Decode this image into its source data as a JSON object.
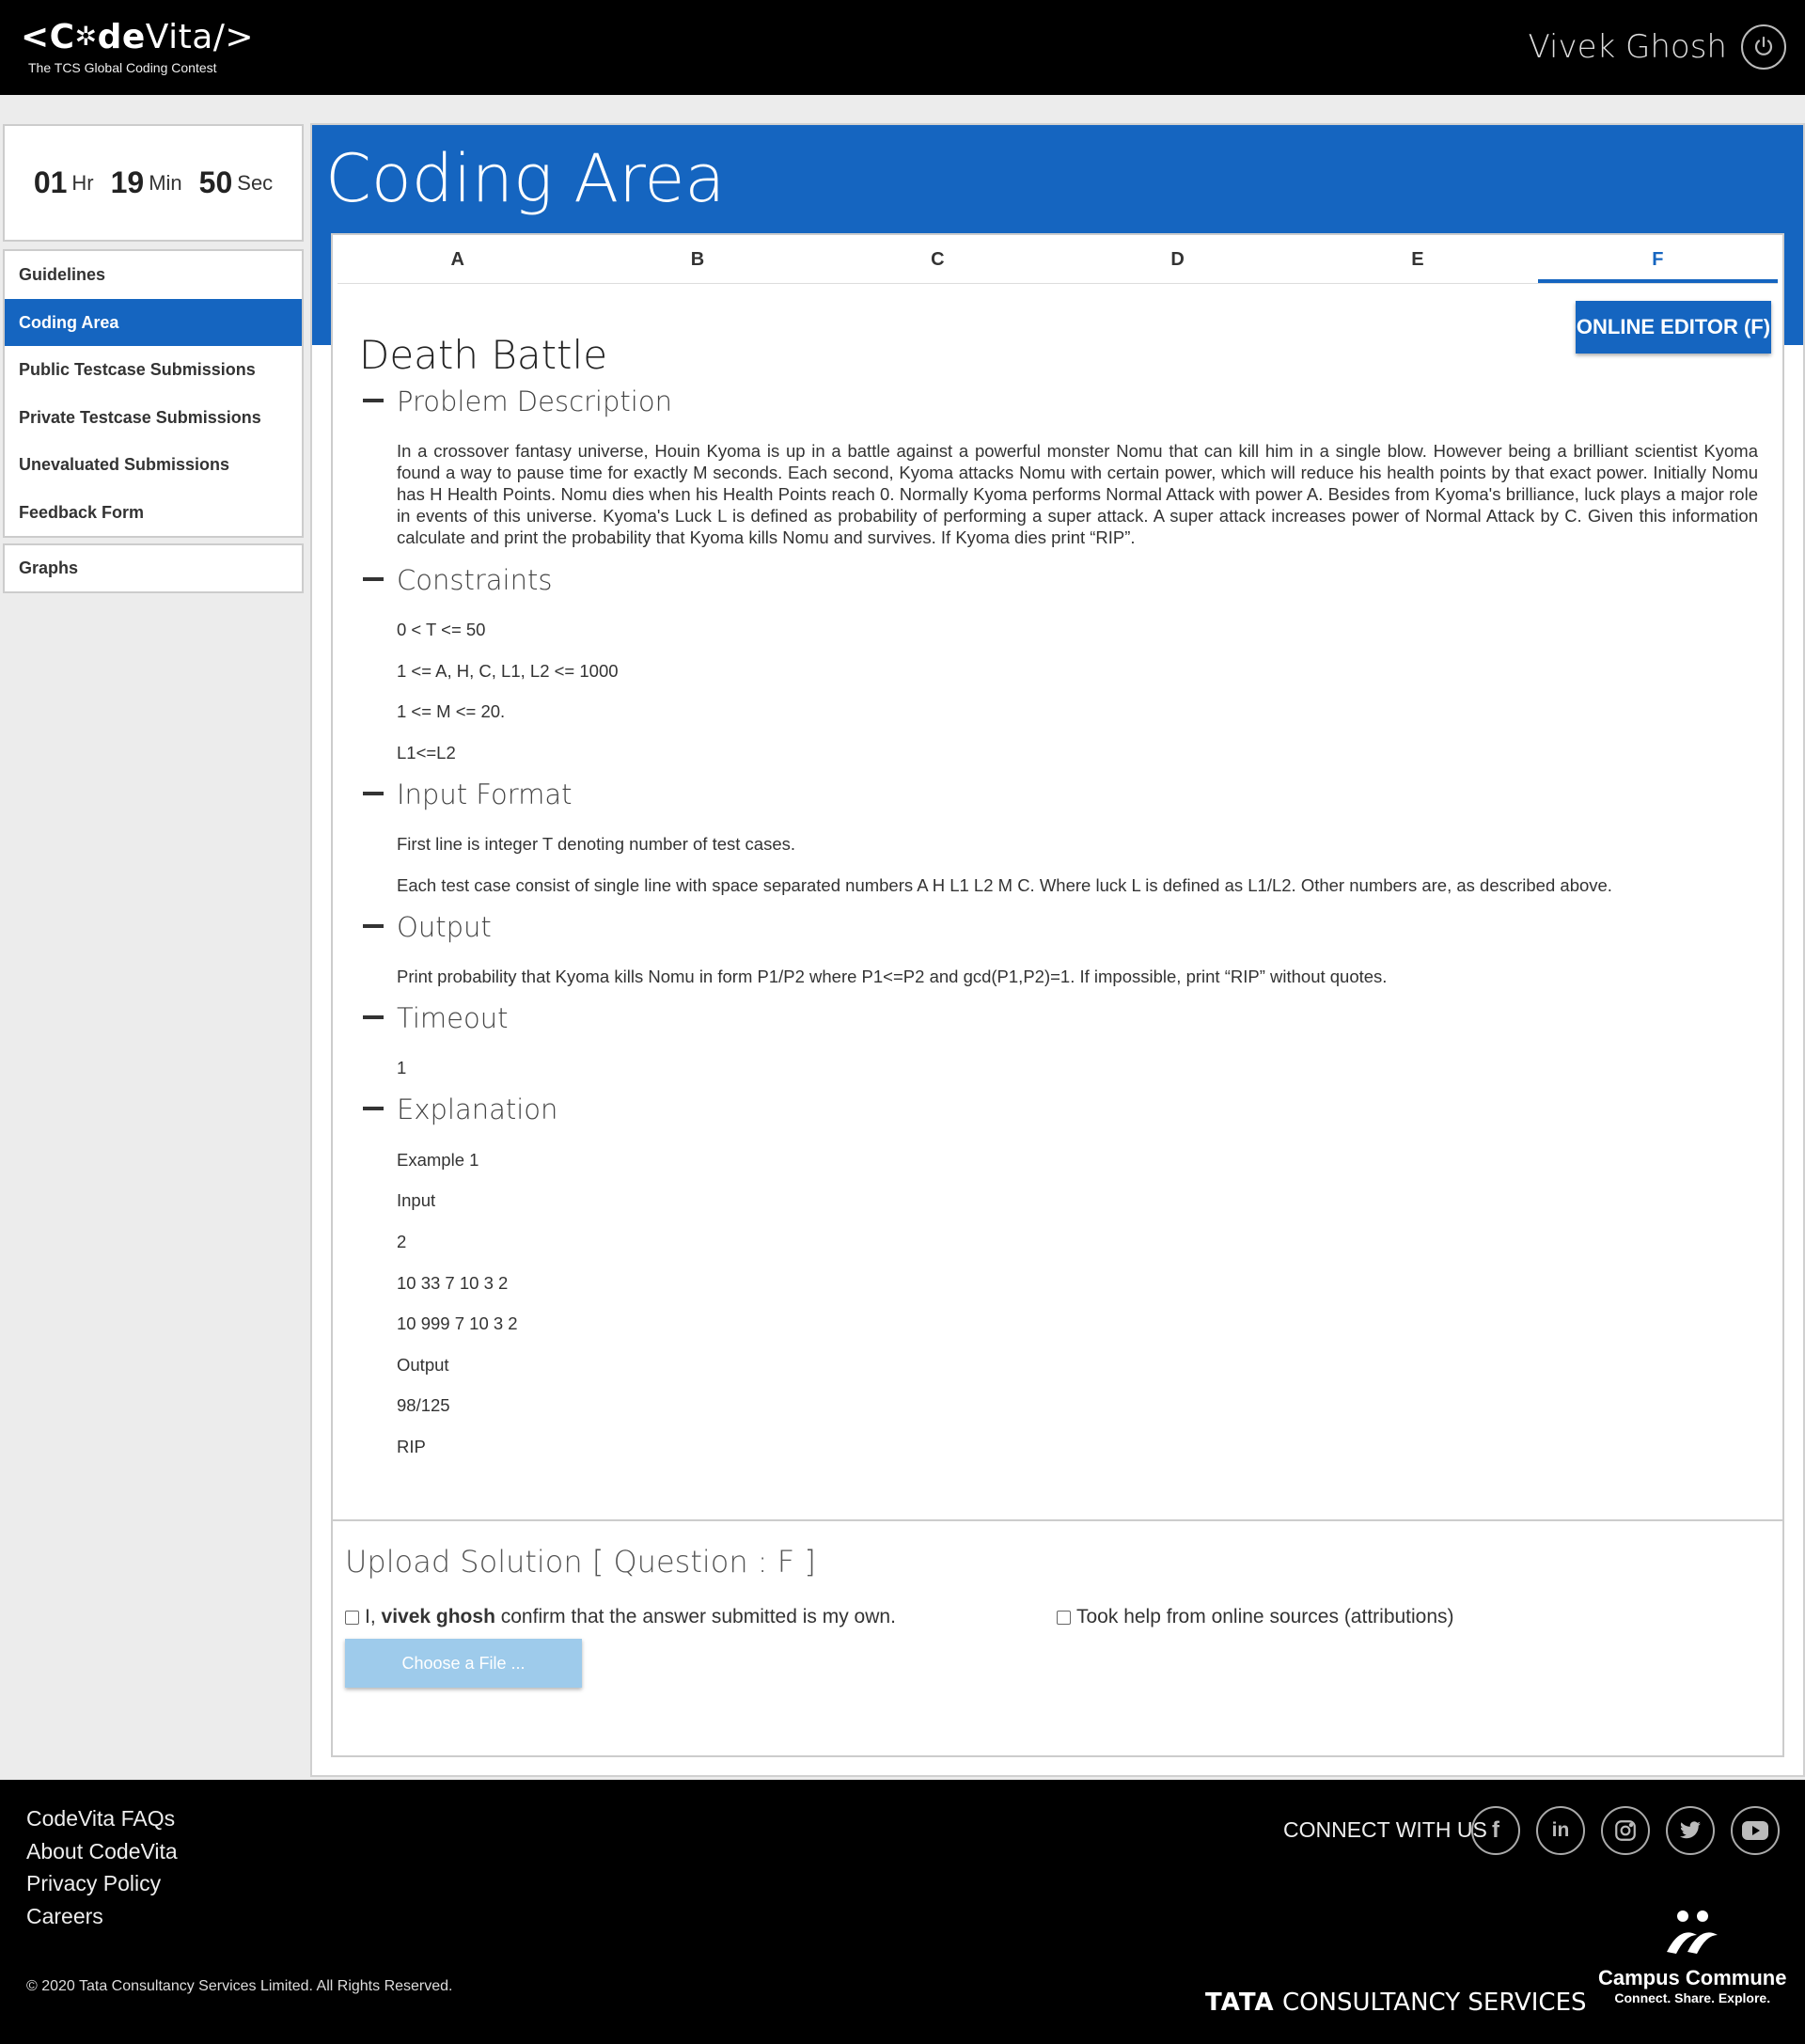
{
  "header": {
    "logo_text_a": "<C",
    "logo_text_b": "de",
    "logo_text_c": "Vita/>",
    "logo_subtitle": "The TCS Global Coding Contest",
    "user_name": "Vivek Ghosh"
  },
  "timer": {
    "hours": "01",
    "hours_unit": "Hr",
    "minutes": "19",
    "minutes_unit": "Min",
    "seconds": "50",
    "seconds_unit": "Sec"
  },
  "sidebar": {
    "items": [
      {
        "label": "Guidelines"
      },
      {
        "label": "Coding Area"
      },
      {
        "label": "Public Testcase Submissions"
      },
      {
        "label": "Private Testcase Submissions"
      },
      {
        "label": "Unevaluated Submissions"
      },
      {
        "label": "Feedback Form"
      }
    ],
    "graphs_label": "Graphs"
  },
  "main": {
    "title": "Coding Area",
    "tabs": [
      {
        "label": "A"
      },
      {
        "label": "B"
      },
      {
        "label": "C"
      },
      {
        "label": "D"
      },
      {
        "label": "E"
      },
      {
        "label": "F"
      }
    ],
    "editor_button": "ONLINE EDITOR (F)"
  },
  "problem": {
    "title": "Death Battle",
    "description_heading": "Problem Description",
    "description": "In a crossover fantasy universe, Houin Kyoma is up in a battle against a powerful monster Nomu that can kill him in a single blow. However being a brilliant scientist Kyoma found a way to pause time for exactly M seconds. Each second, Kyoma attacks Nomu with certain power, which will reduce his health points by that exact power. Initially Nomu has H Health Points. Nomu dies when his Health Points reach 0. Normally Kyoma performs Normal Attack with power A. Besides from Kyoma's brilliance, luck plays a major role in events of this universe. Kyoma's Luck L is defined as probability of performing a super attack. A super attack increases power of Normal Attack by C. Given this information calculate and print the probability that Kyoma kills Nomu and survives. If Kyoma dies print “RIP”.",
    "constraints_heading": "Constraints",
    "constraints": [
      "0 < T <= 50",
      "1 <= A, H, C, L1, L2 <= 1000",
      "1 <= M <= 20.",
      "L1<=L2"
    ],
    "input_heading": "Input Format",
    "input_lines": [
      "First line is integer T denoting number of test cases.",
      "Each test case consist of single line with space separated numbers A H L1 L2 M C. Where luck L is defined as L1/L2. Other numbers are, as described above."
    ],
    "output_heading": "Output",
    "output_text": "Print probability that Kyoma kills Nomu in form P1/P2 where P1<=P2 and gcd(P1,P2)=1. If impossible, print “RIP” without quotes.",
    "timeout_heading": "Timeout",
    "timeout_value": "1",
    "explanation_heading": "Explanation",
    "explanation_lines": [
      "Example 1",
      "Input",
      "2",
      "10 33 7 10 3 2",
      "10 999 7 10 3 2",
      "Output",
      "98/125",
      "RIP"
    ]
  },
  "upload": {
    "title": "Upload Solution [ Question : F ]",
    "confirm_prefix": "I,",
    "confirm_name": "vivek ghosh",
    "confirm_suffix": "confirm that the answer submitted is my own.",
    "help_label": "Took help from online sources (attributions)",
    "choose_button": "Choose a File ..."
  },
  "footer": {
    "links": [
      "CodeVita FAQs",
      "About CodeVita",
      "Privacy Policy",
      "Careers"
    ],
    "copyright": "© 2020 Tata Consultancy Services Limited. All Rights Reserved.",
    "connect_label": "CONNECT WITH US",
    "social_icons": [
      "facebook-icon",
      "linkedin-icon",
      "instagram-icon",
      "twitter-icon",
      "youtube-icon"
    ],
    "tcs_bold": "TATA",
    "tcs_rest": "CONSULTANCY SERVICES",
    "cc_name": "Campus Commune",
    "cc_tagline": "Connect. Share. Explore."
  },
  "colors": {
    "accent": "#1565c0",
    "header_bg": "#000000",
    "page_bg": "#ececec",
    "choose_button": "#9ecbeb"
  }
}
